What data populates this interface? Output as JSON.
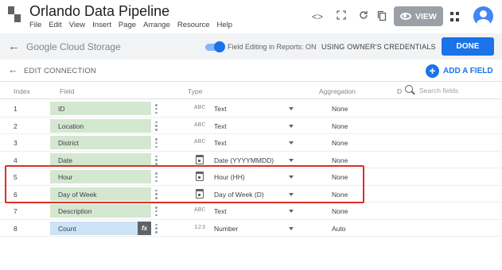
{
  "app": {
    "title": "Orlando Data Pipeline",
    "menu": [
      "File",
      "Edit",
      "View",
      "Insert",
      "Page",
      "Arrange",
      "Resource",
      "Help"
    ],
    "view_label": "VIEW"
  },
  "toolbar_icons": [
    "code-icon",
    "fullscreen-icon",
    "refresh-icon",
    "copy-icon"
  ],
  "datasource": {
    "name": "Google Cloud Storage",
    "field_editing_label": "Field Editing in Reports: ON",
    "credentials_label": "USING OWNER'S CREDENTIALS",
    "done_label": "DONE"
  },
  "edit": {
    "label": "EDIT CONNECTION",
    "add_field_label": "ADD A FIELD"
  },
  "table": {
    "headers": {
      "index": "Index",
      "field": "Field",
      "type": "Type",
      "aggregation": "Aggregation",
      "d": "D"
    },
    "search_placeholder": "Search fields",
    "rows": [
      {
        "index": "1",
        "field": "ID",
        "type_icon": "ABC",
        "type": "Text",
        "aggregation": "None"
      },
      {
        "index": "2",
        "field": "Location",
        "type_icon": "ABC",
        "type": "Text",
        "aggregation": "None"
      },
      {
        "index": "3",
        "field": "District",
        "type_icon": "ABC",
        "type": "Text",
        "aggregation": "None"
      },
      {
        "index": "4",
        "field": "Date",
        "type_icon": "calendar",
        "type": "Date (YYYYMMDD)",
        "aggregation": "None"
      },
      {
        "index": "5",
        "field": "Hour",
        "type_icon": "calendar",
        "type": "Hour (HH)",
        "aggregation": "None"
      },
      {
        "index": "6",
        "field": "Day of Week",
        "type_icon": "calendar",
        "type": "Day of Week (D)",
        "aggregation": "None"
      },
      {
        "index": "7",
        "field": "Description",
        "type_icon": "ABC",
        "type": "Text",
        "aggregation": "None"
      },
      {
        "index": "8",
        "field": "Count",
        "type_icon": "123",
        "type": "Number",
        "aggregation": "Auto",
        "calculated": true,
        "fx": "fx"
      }
    ]
  },
  "colors": {
    "accent": "#1a73e8",
    "field_chip": "#d4e7d0",
    "calc_chip": "#cde3f7",
    "highlight": "#d93025"
  }
}
